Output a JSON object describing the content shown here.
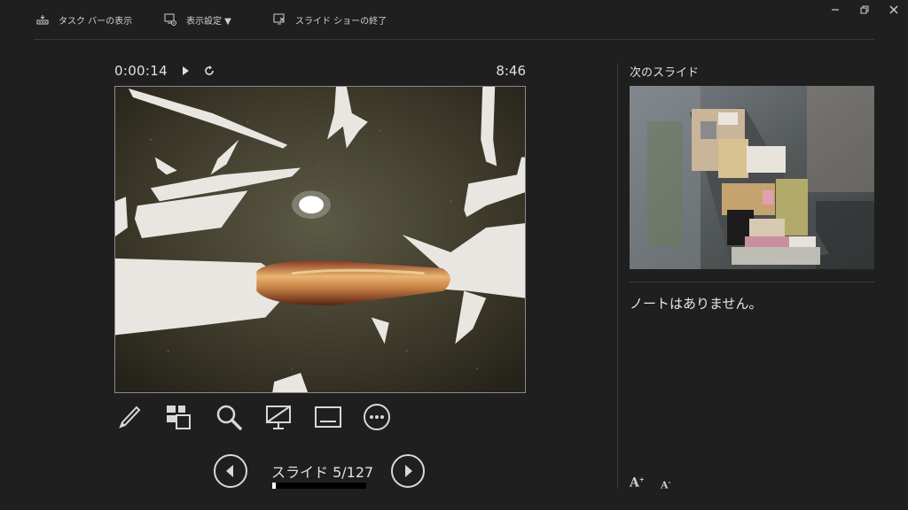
{
  "toolbar": {
    "taskbar_label": "タスク バーの表示",
    "display_settings_label": "表示設定 ▼",
    "end_show_label": "スライド ショーの終了"
  },
  "timer": {
    "elapsed": "0:00:14",
    "clock": "8:46"
  },
  "navigation": {
    "slide_counter": "スライド 5/127",
    "current_slide": 5,
    "total_slides": 127
  },
  "right_pane": {
    "next_slide_label": "次のスライド",
    "notes_text": "ノートはありません。"
  },
  "font_controls": {
    "increase_label": "A",
    "increase_mark": "+",
    "decrease_label": "A",
    "decrease_mark": "-"
  },
  "icons": {
    "taskbar": "taskbar-icon",
    "display": "display-settings-icon",
    "end": "end-show-icon",
    "pause": "play-icon",
    "reset": "reset-icon",
    "pen": "pen-icon",
    "grid": "see-all-slides-icon",
    "zoom": "zoom-icon",
    "black": "black-screen-icon",
    "subtitles": "subtitles-icon",
    "more": "more-options-icon",
    "prev": "previous-slide-icon",
    "next": "next-slide-icon"
  },
  "colors": {
    "background": "#1f1f1f",
    "text": "#e0e0e0",
    "divider": "#3a3a3a"
  }
}
